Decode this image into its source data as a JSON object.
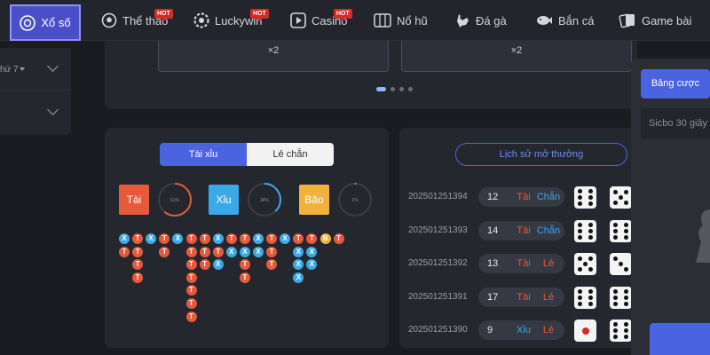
{
  "nav": {
    "items": [
      {
        "id": "xoso",
        "label": "Xổ số",
        "icon": "lottery-ball-icon",
        "hot": false,
        "active": true
      },
      {
        "id": "thethao",
        "label": "Thể thao",
        "icon": "soccer-ball-icon",
        "hot": true
      },
      {
        "id": "luckywin",
        "label": "Luckywin",
        "icon": "chip-icon",
        "hot": true
      },
      {
        "id": "casino",
        "label": "Casino",
        "icon": "play-icon",
        "hot": true
      },
      {
        "id": "nohu",
        "label": "Nổ hũ",
        "icon": "slot-machine-icon",
        "hot": false
      },
      {
        "id": "daga",
        "label": "Đá gà",
        "icon": "rooster-icon",
        "hot": false
      },
      {
        "id": "banca",
        "label": "Bắn cá",
        "icon": "fish-icon",
        "hot": false
      },
      {
        "id": "gamebai",
        "label": "Game bài",
        "icon": "cards-icon",
        "hot": false
      }
    ],
    "hot_label": "HOT"
  },
  "left_panel": {
    "row1": "hứ 7"
  },
  "slots": {
    "card1": "×2",
    "card2": "×2",
    "pages": 4,
    "current_page": 1
  },
  "stats": {
    "tab_active": "Tài xỉu",
    "tab_inactive": "Lẻ chẵn",
    "categories": [
      {
        "label": "Tài",
        "percent": 61,
        "percent_text": "61%",
        "color": "#e55a3a"
      },
      {
        "label": "Xỉu",
        "percent": 38,
        "percent_text": "38%",
        "color": "#3aa9e8"
      },
      {
        "label": "Bão",
        "percent": 1,
        "percent_text": "1%",
        "color": "#f0b23a"
      }
    ],
    "road": [
      [
        "X",
        "T"
      ],
      [
        "T",
        "T",
        "T",
        "T"
      ],
      [
        "X"
      ],
      [
        "T",
        "T"
      ],
      [
        "X"
      ],
      [
        "T",
        "T",
        "T",
        "T",
        "T",
        "T",
        "T"
      ],
      [
        "T",
        "T",
        "T"
      ],
      [
        "X",
        "T",
        "X"
      ],
      [
        "T",
        "X"
      ],
      [
        "T",
        "X",
        "T",
        "T"
      ],
      [
        "X",
        "X"
      ],
      [
        "T",
        "T",
        "T"
      ],
      [
        "X"
      ],
      [
        "T",
        "X",
        "X",
        "X"
      ],
      [
        "T",
        "X",
        "X"
      ],
      [
        "B"
      ],
      [
        "T"
      ]
    ]
  },
  "history": {
    "button": "Lịch sử mở thưởng",
    "rows": [
      {
        "id": "202501251394",
        "total": "12",
        "result1": "Tài",
        "result2": "Chẵn",
        "dice": [
          6,
          5
        ]
      },
      {
        "id": "202501251393",
        "total": "14",
        "result1": "Tài",
        "result2": "Chẵn",
        "dice": [
          6,
          6
        ]
      },
      {
        "id": "202501251392",
        "total": "13",
        "result1": "Tài",
        "result2": "Lẻ",
        "dice": [
          5,
          3
        ]
      },
      {
        "id": "202501251391",
        "total": "17",
        "result1": "Tài",
        "result2": "Lẻ",
        "dice": [
          6,
          6
        ]
      },
      {
        "id": "202501251390",
        "total": "9",
        "result1": "Xỉu",
        "result2": "Lẻ",
        "dice": [
          1,
          6
        ]
      }
    ]
  },
  "right_panel": {
    "tab": "Bảng cược",
    "game": "Sicbo 30 giây"
  }
}
